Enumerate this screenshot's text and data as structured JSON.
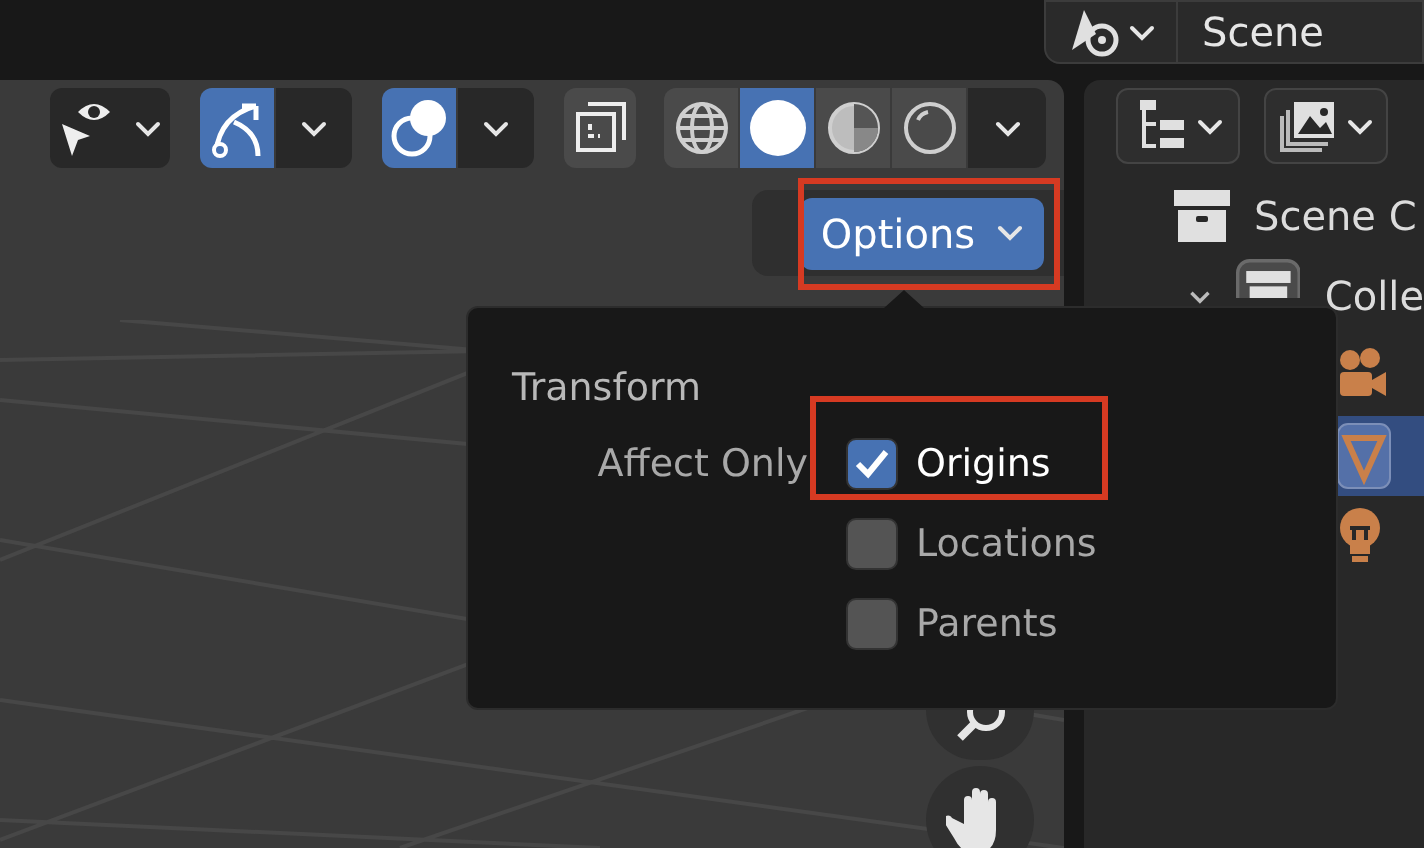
{
  "top_bar": {
    "scene_name": "Scene"
  },
  "viewport_header": {
    "visibility_on": false,
    "gizmo_on": true,
    "overlays_on": true,
    "xray_on": false,
    "shading_modes": [
      {
        "kind": "wireframe",
        "selected": false
      },
      {
        "kind": "solid",
        "selected": true
      },
      {
        "kind": "material",
        "selected": false
      },
      {
        "kind": "rendered",
        "selected": false
      }
    ]
  },
  "options_button": {
    "label": "Options",
    "highlighted": true
  },
  "options_popover": {
    "section": "Transform",
    "label": "Affect Only",
    "options": [
      {
        "label": "Origins",
        "checked": true,
        "highlighted": true
      },
      {
        "label": "Locations",
        "checked": false,
        "highlighted": false
      },
      {
        "label": "Parents",
        "checked": false,
        "highlighted": false
      }
    ]
  },
  "outliner": {
    "tree": [
      {
        "kind": "scene_collection",
        "label": "Scene C",
        "children": [
          {
            "kind": "collection",
            "label": "Colle",
            "expanded": true,
            "children": [
              {
                "kind": "camera",
                "selected": false
              },
              {
                "kind": "cone",
                "selected": true
              },
              {
                "kind": "light",
                "selected": false
              }
            ]
          }
        ]
      }
    ]
  }
}
